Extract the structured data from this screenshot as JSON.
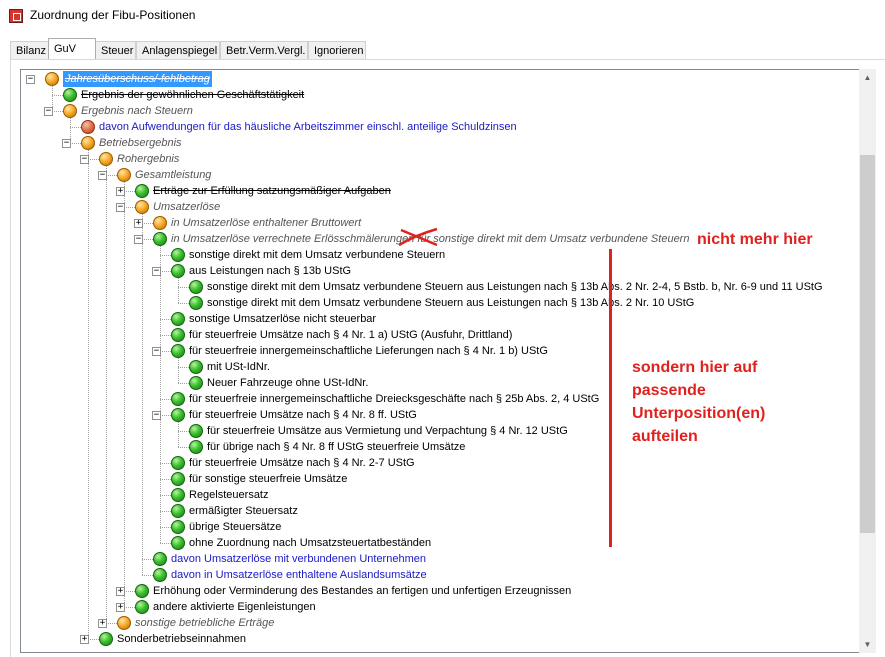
{
  "window": {
    "title": "Zuordnung der Fibu-Positionen"
  },
  "tabs": [
    "Bilanz",
    "GuV",
    "Steuer",
    "Anlagenspiegel",
    "Betr.Verm.Vergl.",
    "Ignorieren"
  ],
  "active_tab": "GuV",
  "tree": [
    {
      "label": "Jahresüberschuss/-fehlbetrag",
      "status": "orange",
      "expander": "−",
      "style": "selected"
    },
    {
      "label": "Ergebnis der gewöhnlichen Geschäftstätigkeit",
      "status": "green",
      "style": "strike"
    },
    {
      "label": "Ergebnis nach Steuern",
      "status": "orange",
      "expander": "−",
      "style": "italic"
    },
    {
      "label": "davon Aufwendungen für das häusliche Arbeitszimmer einschl. anteilige Schuldzinsen",
      "status": "red",
      "style": "blue"
    },
    {
      "label": "Betriebsergebnis",
      "status": "orange",
      "expander": "−",
      "style": "italic"
    },
    {
      "label": "Rohergebnis",
      "status": "orange",
      "expander": "−",
      "style": "italic"
    },
    {
      "label": "Gesamtleistung",
      "status": "orange",
      "expander": "−",
      "style": "italic"
    },
    {
      "label": "Erträge zur Erfüllung satzungsmäßiger Aufgaben",
      "status": "green",
      "expander": "+",
      "style": "strike"
    },
    {
      "label": "Umsatzerlöse",
      "status": "orange",
      "expander": "−",
      "style": "italic"
    },
    {
      "label": "in Umsatzerlöse enthaltener Bruttowert",
      "status": "orange",
      "expander": "+",
      "style": "italic"
    },
    {
      "label": "in Umsatzerlöse verrechnete Erlösschmälerungen für sonstige direkt mit dem Umsatz verbundene Steuern",
      "status": "green",
      "expander": "−",
      "style": "italic"
    },
    {
      "label": "sonstige direkt mit dem Umsatz verbundene Steuern",
      "status": "green"
    },
    {
      "label": "aus Leistungen nach § 13b UStG",
      "status": "green",
      "expander": "−"
    },
    {
      "label": "sonstige direkt mit dem Umsatz verbundene Steuern aus Leistungen nach § 13b Abs. 2 Nr. 2-4, 5 Bstb. b, Nr. 6-9 und 11 UStG",
      "status": "green"
    },
    {
      "label": "sonstige direkt mit dem Umsatz verbundene Steuern aus Leistungen nach § 13b Abs. 2 Nr. 10 UStG",
      "status": "green"
    },
    {
      "label": "sonstige Umsatzerlöse nicht steuerbar",
      "status": "green"
    },
    {
      "label": "für steuerfreie Umsätze nach § 4 Nr. 1 a) UStG (Ausfuhr, Drittland)",
      "status": "green"
    },
    {
      "label": "für steuerfreie innergemeinschaftliche Lieferungen nach § 4 Nr. 1 b) UStG",
      "status": "green",
      "expander": "−"
    },
    {
      "label": "mit USt-IdNr.",
      "status": "green"
    },
    {
      "label": "Neuer Fahrzeuge ohne USt-IdNr.",
      "status": "green"
    },
    {
      "label": "für steuerfreie innergemeinschaftliche Dreiecksgeschäfte nach § 25b Abs. 2, 4 UStG",
      "status": "green"
    },
    {
      "label": "für steuerfreie Umsätze nach § 4 Nr. 8 ff. UStG",
      "status": "green",
      "expander": "−"
    },
    {
      "label": "für steuerfreie Umsätze aus Vermietung und Verpachtung § 4 Nr. 12 UStG",
      "status": "green"
    },
    {
      "label": "für übrige nach § 4 Nr. 8 ff UStG steuerfreie Umsätze",
      "status": "green"
    },
    {
      "label": "für steuerfreie Umsätze nach § 4 Nr. 2-7 UStG",
      "status": "green"
    },
    {
      "label": "für sonstige steuerfreie Umsätze",
      "status": "green"
    },
    {
      "label": "Regelsteuersatz",
      "status": "green"
    },
    {
      "label": "ermäßigter Steuersatz",
      "status": "green"
    },
    {
      "label": "übrige Steuersätze",
      "status": "green"
    },
    {
      "label": "ohne Zuordnung nach Umsatzsteuertatbeständen",
      "status": "green"
    },
    {
      "label": "davon Umsatzerlöse mit verbundenen Unternehmen",
      "status": "green",
      "style": "blue"
    },
    {
      "label": "davon in Umsatzerlöse enthaltene Auslandsumsätze",
      "status": "green",
      "style": "blue"
    },
    {
      "label": "Erhöhung oder Verminderung des Bestandes an fertigen und unfertigen Erzeugnissen",
      "status": "green",
      "expander": "+"
    },
    {
      "label": "andere aktivierte Eigenleistungen",
      "status": "green",
      "expander": "+"
    },
    {
      "label": "sonstige betriebliche Erträge",
      "status": "orange",
      "expander": "+",
      "style": "italic"
    },
    {
      "label": "Sonderbetriebseinnahmen",
      "status": "green",
      "expander": "+"
    }
  ],
  "annotations": {
    "not_here": "nicht mehr hier",
    "split_lines": [
      "sondern hier auf",
      "passende",
      "Unterposition(en)",
      "aufteilen"
    ]
  },
  "colors": {
    "annotation": "#e0221f",
    "selection": "#3399ff",
    "link_blue": "#1a1ac8"
  }
}
